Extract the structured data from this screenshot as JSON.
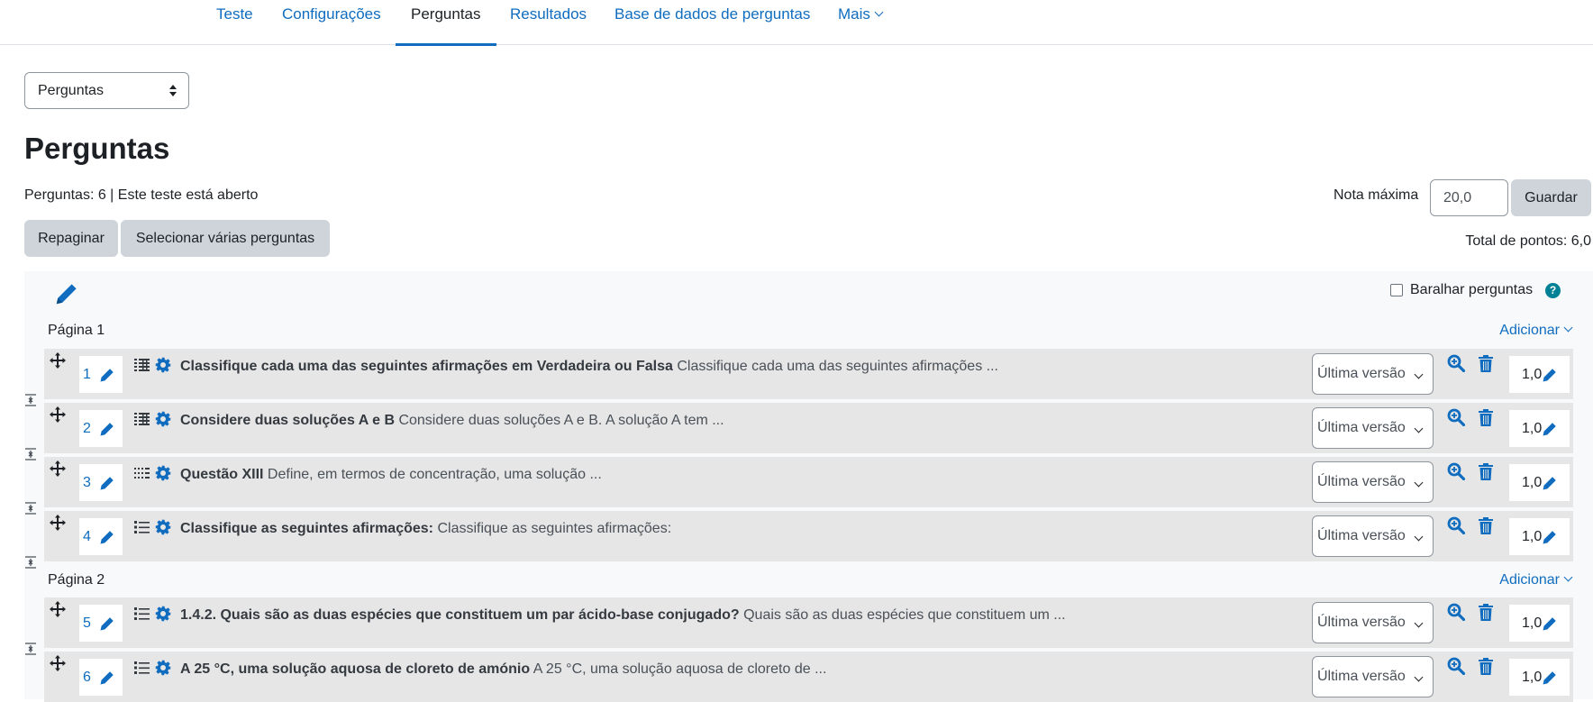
{
  "nav": {
    "tabs": [
      {
        "label": "Teste",
        "active": false
      },
      {
        "label": "Configurações",
        "active": false
      },
      {
        "label": "Perguntas",
        "active": true
      },
      {
        "label": "Resultados",
        "active": false
      },
      {
        "label": "Base de dados de perguntas",
        "active": false
      },
      {
        "label": "Mais",
        "active": false
      }
    ]
  },
  "page_select": {
    "value": "Perguntas"
  },
  "heading": "Perguntas",
  "status": "Perguntas: 6 | Este teste está aberto",
  "buttons": {
    "repaginate": "Repaginar",
    "select_multiple": "Selecionar várias perguntas",
    "save": "Guardar"
  },
  "max_grade": {
    "label": "Nota máxima",
    "value": "20,0"
  },
  "total_points": "Total de pontos: 6,0",
  "shuffle": {
    "label": "Baralhar perguntas",
    "checked": false,
    "help": "?"
  },
  "pages": [
    {
      "label": "Página 1",
      "add_label": "Adicionar"
    },
    {
      "label": "Página 2",
      "add_label": "Adicionar"
    }
  ],
  "questions": [
    {
      "number": "1",
      "type_icon": "multichoice-grid-icon",
      "title": "Classifique cada uma das seguintes afirmações em Verdadeira ou Falsa",
      "preview": "Classifique cada uma das seguintes afirmações ...",
      "version": "Última versão",
      "mark": "1,0"
    },
    {
      "number": "2",
      "type_icon": "multichoice-grid-icon",
      "title": "Considere duas soluções A e B",
      "preview": "Considere duas soluções A e B. A solução A tem ...",
      "version": "Última versão",
      "mark": "1,0"
    },
    {
      "number": "3",
      "type_icon": "dotted-list-icon",
      "title": "Questão XIII",
      "preview": "Define, em termos de concentração, uma solução ...",
      "version": "Última versão",
      "mark": "1,0"
    },
    {
      "number": "4",
      "type_icon": "checklist-icon",
      "title": "Classifique as seguintes afirmações:",
      "preview": "Classifique as seguintes afirmações:",
      "version": "Última versão",
      "mark": "1,0"
    },
    {
      "number": "5",
      "type_icon": "checklist-icon",
      "title": "1.4.2. Quais são as duas espécies que constituem um par ácido-base conjugado?",
      "preview": "Quais são as duas espécies que constituem um ...",
      "version": "Última versão",
      "mark": "1,0"
    },
    {
      "number": "6",
      "type_icon": "checklist-icon",
      "title": "A 25 °C, uma solução aquosa de cloreto de amónio",
      "preview": "A 25 °C, uma solução aquosa de cloreto de ...",
      "version": "Última versão",
      "mark": "1,0"
    }
  ],
  "colors": {
    "link": "#0f6cbf",
    "row_bg": "#e6e6e6",
    "panel_bg": "#f8f9fa",
    "button_bg": "#ced4da"
  }
}
